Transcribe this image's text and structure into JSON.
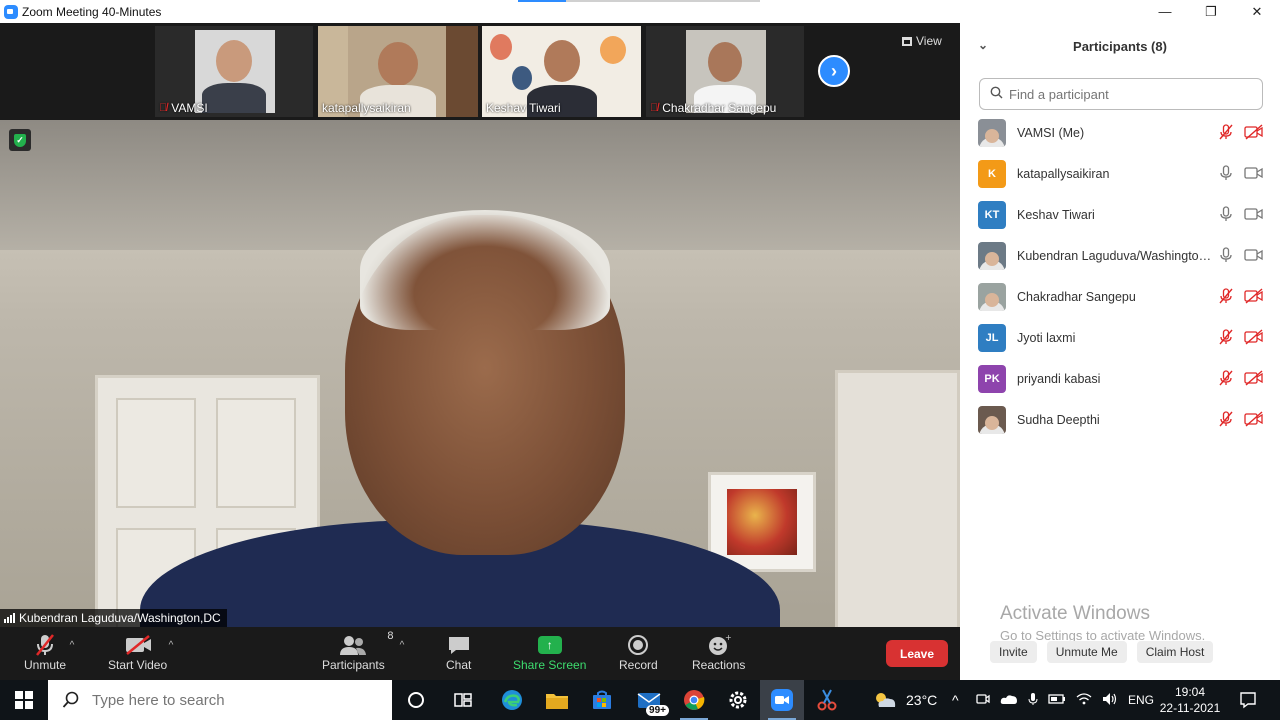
{
  "window": {
    "title": "Zoom Meeting 40-Minutes",
    "top_progress_fraction": 0.2,
    "controls": {
      "minimize": "—",
      "maximize": "❐",
      "close": "✕"
    }
  },
  "video_strip": {
    "thumbnails": [
      {
        "name": "VAMSI",
        "muted": true
      },
      {
        "name": "katapallysaikiran",
        "muted": false
      },
      {
        "name": "Keshav Tiwari",
        "muted": false
      },
      {
        "name": "Chakradhar Sangepu",
        "muted": true
      }
    ],
    "view_label": "View"
  },
  "main_video": {
    "speaker": "Kubendran Laguduva/Washington,DC"
  },
  "toolbar": {
    "unmute": "Unmute",
    "start_video": "Start Video",
    "participants": "Participants",
    "participants_count": "8",
    "chat": "Chat",
    "share_screen": "Share Screen",
    "record": "Record",
    "reactions": "Reactions",
    "leave": "Leave"
  },
  "participants_panel": {
    "title": "Participants (8)",
    "search_placeholder": "Find a participant",
    "participants": [
      {
        "name": "VAMSI (Me)",
        "initials": "",
        "color": "#8a8f96",
        "mic_muted": true,
        "video_off": true
      },
      {
        "name": "katapallysaikiran",
        "initials": "K",
        "color": "#f39a17",
        "mic_muted": false,
        "video_off": false
      },
      {
        "name": "Keshav Tiwari",
        "initials": "KT",
        "color": "#2f7ec2",
        "mic_muted": false,
        "video_off": false
      },
      {
        "name": "Kubendran Laguduva/Washington,...",
        "initials": "",
        "color": "#6c7a86",
        "mic_muted": false,
        "video_off": false
      },
      {
        "name": "Chakradhar Sangepu",
        "initials": "",
        "color": "#9aa3a0",
        "mic_muted": true,
        "video_off": true
      },
      {
        "name": "Jyoti laxmi",
        "initials": "JL",
        "color": "#2f7ec2",
        "mic_muted": true,
        "video_off": true
      },
      {
        "name": "priyandi kabasi",
        "initials": "PK",
        "color": "#8e44ad",
        "mic_muted": true,
        "video_off": true
      },
      {
        "name": "Sudha Deepthi",
        "initials": "",
        "color": "#6b5a4f",
        "mic_muted": true,
        "video_off": true
      }
    ],
    "activate_windows_title": "Activate Windows",
    "activate_windows_sub": "Go to Settings to activate Windows.",
    "footer": {
      "invite": "Invite",
      "unmute_me": "Unmute Me",
      "claim_host": "Claim Host"
    }
  },
  "taskbar": {
    "search_placeholder": "Type here to search",
    "mail_badge": "99+",
    "weather": "23°C",
    "language": "ENG",
    "time": "19:04",
    "date": "22-11-2021"
  },
  "colors": {
    "zoom_blue": "#2d8cff",
    "leave_red": "#d83232",
    "share_green": "#23b14d",
    "muted_red": "#e02828"
  }
}
